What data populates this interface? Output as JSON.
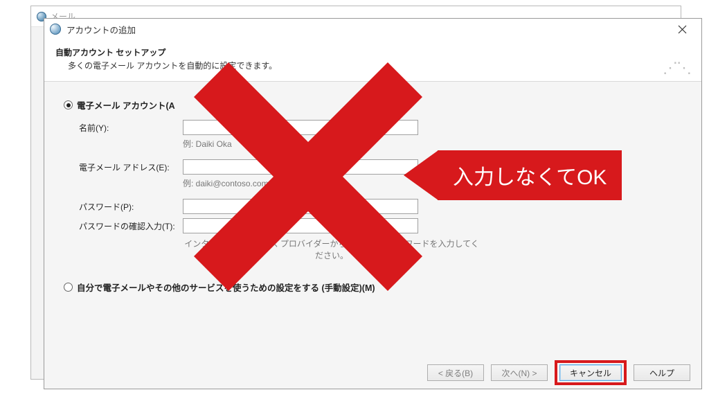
{
  "bg_window": {
    "title": "メール"
  },
  "dialog": {
    "title": "アカウントの追加",
    "header_title": "自動アカウント セットアップ",
    "header_sub": "多くの電子メール アカウントを自動的に設定できます。",
    "radio_email": "電子メール アカウント(A",
    "labels": {
      "name": "名前(Y):",
      "email": "電子メール アドレス(E):",
      "password": "パスワード(P):",
      "password_confirm": "パスワードの確認入力(T):"
    },
    "examples": {
      "name": "例: Daiki Oka",
      "email": "例: daiki@contoso.com"
    },
    "isp_hint": "インターネット サービス プロバイダーから提供されたパスワードを入力してください。",
    "radio_manual": "自分で電子メールやその他のサービスを使うための設定をする (手動設定)(M)",
    "buttons": {
      "back": "< 戻る(B)",
      "next": "次へ(N) >",
      "cancel": "キャンセル",
      "help": "ヘルプ"
    }
  },
  "callout_text": "入力しなくてOK",
  "colors": {
    "accent_red": "#d7191c"
  }
}
